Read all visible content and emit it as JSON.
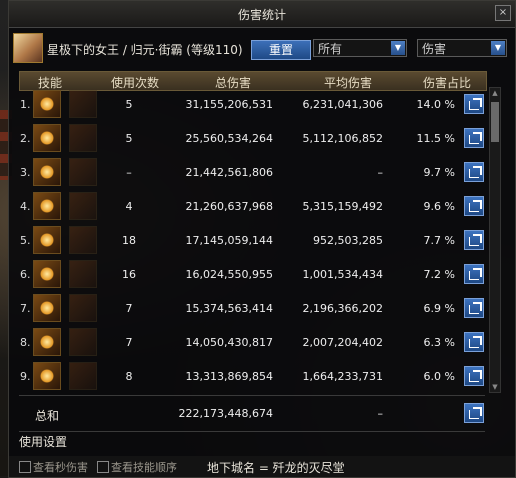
{
  "window": {
    "title": "伤害统计",
    "close_label": "×"
  },
  "character": {
    "name": "星极下的女王 / 归元·街霸 (等级110)"
  },
  "controls": {
    "reset_label": "重置",
    "scope_value": "所有",
    "metric_value": "伤害"
  },
  "table": {
    "headers": {
      "skill": "技能",
      "count": "使用次数",
      "total": "总伤害",
      "average": "平均伤害",
      "pct": "伤害占比"
    },
    "rows": [
      {
        "rank": "1.",
        "count": "5",
        "total": "31,155,206,531",
        "average": "6,231,041,306",
        "pct": "14.0 %"
      },
      {
        "rank": "2.",
        "count": "5",
        "total": "25,560,534,264",
        "average": "5,112,106,852",
        "pct": "11.5 %"
      },
      {
        "rank": "3.",
        "count": "–",
        "total": "21,442,561,806",
        "average": "–",
        "pct": "9.7 %"
      },
      {
        "rank": "4.",
        "count": "4",
        "total": "21,260,637,968",
        "average": "5,315,159,492",
        "pct": "9.6 %"
      },
      {
        "rank": "5.",
        "count": "18",
        "total": "17,145,059,144",
        "average": "952,503,285",
        "pct": "7.7 %"
      },
      {
        "rank": "6.",
        "count": "16",
        "total": "16,024,550,955",
        "average": "1,001,534,434",
        "pct": "7.2 %"
      },
      {
        "rank": "7.",
        "count": "7",
        "total": "15,374,563,414",
        "average": "2,196,366,202",
        "pct": "6.9 %"
      },
      {
        "rank": "8.",
        "count": "7",
        "total": "14,050,430,817",
        "average": "2,007,204,402",
        "pct": "6.3 %"
      },
      {
        "rank": "9.",
        "count": "8",
        "total": "13,313,869,854",
        "average": "1,664,233,731",
        "pct": "6.0 %"
      }
    ],
    "summary": {
      "label": "总和",
      "total": "222,173,448,674",
      "average": "–"
    }
  },
  "settings_label": "使用设置",
  "footer": {
    "check_dps_label": "查看秒伤害",
    "check_order_label": "查看技能顺序",
    "map_label": "地下城名 = 歼龙的灭尽堂"
  }
}
